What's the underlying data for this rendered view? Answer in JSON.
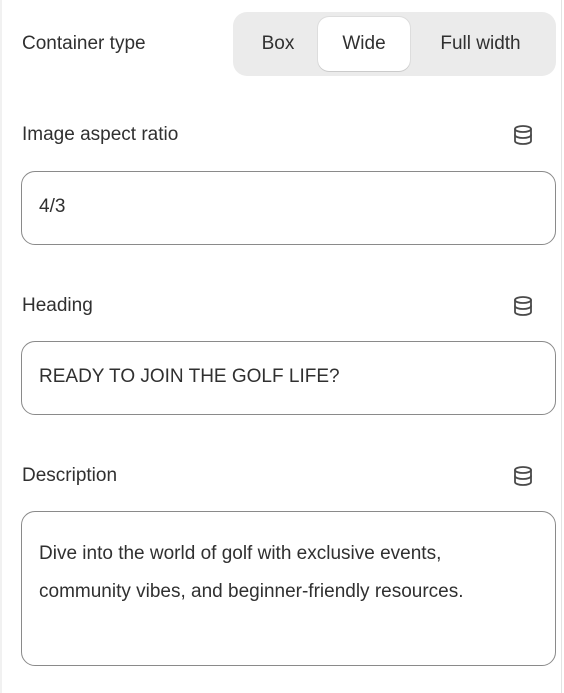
{
  "container_type": {
    "label": "Container type",
    "options": [
      "Box",
      "Wide",
      "Full width"
    ],
    "selected": "Wide"
  },
  "fields": [
    {
      "label": "Image aspect ratio",
      "value": "4/3",
      "icon": "database-icon"
    },
    {
      "label": "Heading",
      "value": "READY TO JOIN THE GOLF LIFE?",
      "icon": "database-icon"
    },
    {
      "label": "Description",
      "value": "Dive into the world of golf with exclusive events, community vibes, and beginner-friendly resources.",
      "icon": "database-icon"
    }
  ],
  "colors": {
    "text": "#303030",
    "segment_bg": "#ebebeb",
    "segment_active_bg": "#ffffff",
    "input_border": "#8a8a8a",
    "icon": "#4a4a4a"
  }
}
